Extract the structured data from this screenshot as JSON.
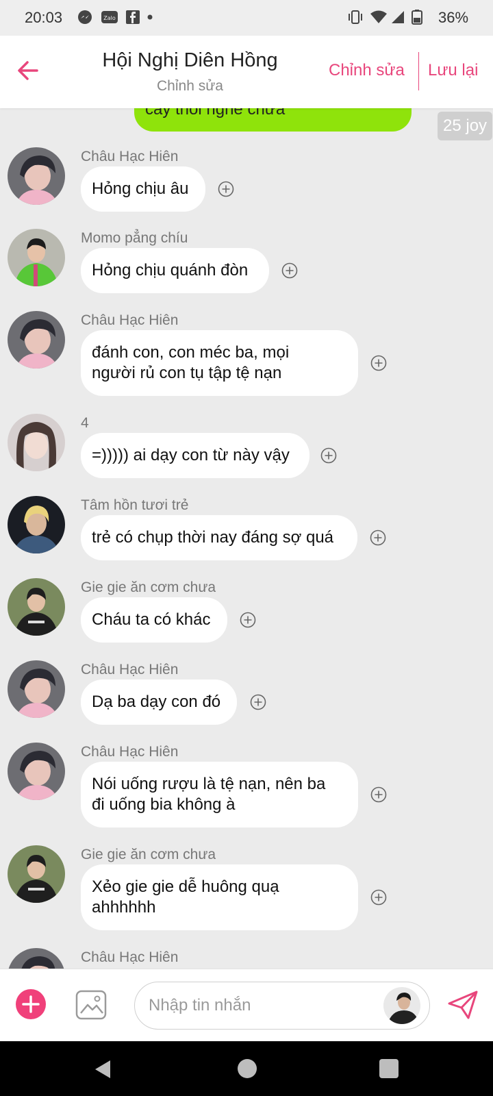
{
  "status_bar": {
    "time": "20:03",
    "left_icons": [
      "messenger-icon",
      "zalo-icon",
      "facebook-icon",
      "dot-icon"
    ],
    "right_icons": [
      "vibrate-icon",
      "wifi-icon",
      "signal-icon",
      "battery-icon"
    ],
    "battery": "36%"
  },
  "header": {
    "title": "Hội Nghị Diên Hồng",
    "subtitle": "Chỉnh sửa",
    "edit_label": "Chỉnh sửa",
    "save_label": "Lưu lại",
    "accent_color": "#e8467c"
  },
  "chat": {
    "own_partial_text": "cay thôi nghe chưa",
    "own_bubble_color": "#8fe30b",
    "joy_badge": "25 joy",
    "messages": [
      {
        "sender": "Châu Hạc Hiên",
        "text": "Hỏng chịu âu"
      },
      {
        "sender": "Momo pẳng chíu",
        "text": "Hỏng chịu quánh đòn"
      },
      {
        "sender": "Châu Hạc Hiên",
        "text_line1": "đánh con, con méc ba, mọi",
        "text_line2": "người rủ con tụ tập tệ nạn"
      },
      {
        "sender": "4",
        "text": "=))))) ai dạy con từ này vậy"
      },
      {
        "sender": "Tâm hồn tươi trẻ",
        "text": "trẻ có chụp thời nay đáng sợ quá"
      },
      {
        "sender": "Gie gie ăn cơm chưa",
        "text": "Cháu ta có khác"
      },
      {
        "sender": "Châu Hạc Hiên",
        "text": "Dạ ba dạy con đó"
      },
      {
        "sender": "Châu Hạc Hiên",
        "text_line1": "Nói uống rượu là tệ nạn, nên ba",
        "text_line2": "đi uống bia không à"
      },
      {
        "sender": "Gie gie ăn cơm chưa",
        "text_line1": "Xẻo gie gie dễ huông quạ",
        "text_line2": "ahhhhhh"
      },
      {
        "sender": "Châu Hạc Hiên"
      }
    ]
  },
  "input_bar": {
    "placeholder": "Nhập tin nhắn",
    "value": ""
  }
}
